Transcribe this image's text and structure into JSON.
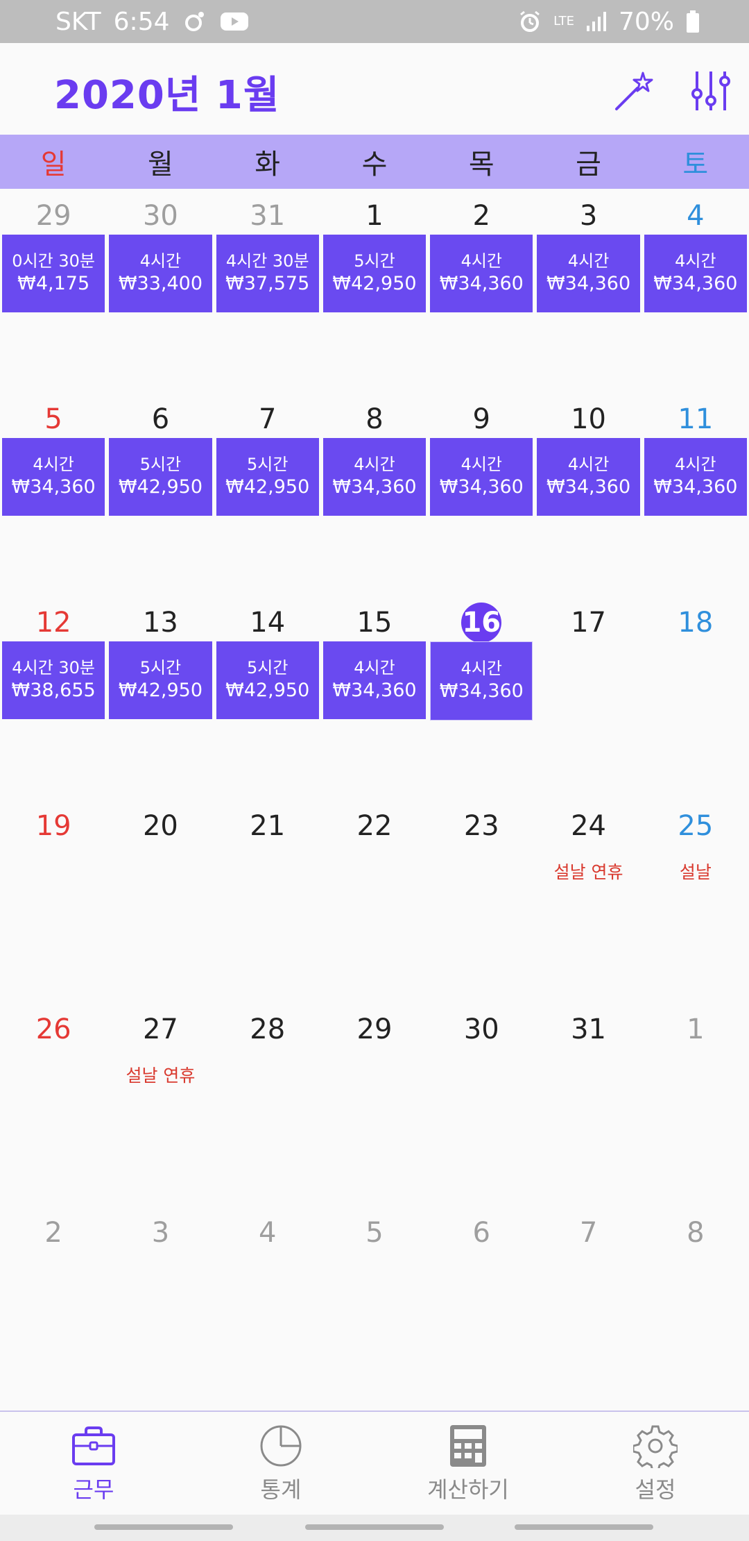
{
  "status_bar": {
    "carrier": "SKT",
    "time": "6:54",
    "network": "LTE",
    "battery": "70%"
  },
  "header": {
    "title": "2020년 1월"
  },
  "weekdays": [
    "일",
    "월",
    "화",
    "수",
    "목",
    "금",
    "토"
  ],
  "calendar": {
    "weeks": [
      [
        {
          "day": "29",
          "muted": true
        },
        {
          "day": "30",
          "muted": true
        },
        {
          "day": "31",
          "muted": true
        },
        {
          "day": "1",
          "hours": "5시간",
          "wage": "₩42,950"
        },
        {
          "day": "2",
          "hours": "4시간",
          "wage": "₩34,360"
        },
        {
          "day": "3",
          "hours": "4시간",
          "wage": "₩34,360"
        },
        {
          "day": "4",
          "hours": "4시간",
          "wage": "₩34,360"
        }
      ],
      [
        {
          "day": "5",
          "hours": "4시간",
          "wage": "₩34,360"
        },
        {
          "day": "6",
          "hours": "5시간",
          "wage": "₩42,950"
        },
        {
          "day": "7",
          "hours": "5시간",
          "wage": "₩42,950"
        },
        {
          "day": "8",
          "hours": "4시간",
          "wage": "₩34,360"
        },
        {
          "day": "9",
          "hours": "4시간",
          "wage": "₩34,360"
        },
        {
          "day": "10",
          "hours": "4시간",
          "wage": "₩34,360"
        },
        {
          "day": "11",
          "hours": "4시간",
          "wage": "₩34,360"
        }
      ],
      [
        {
          "day": "12",
          "hours": "4시간 30분",
          "wage": "₩38,655"
        },
        {
          "day": "13",
          "hours": "5시간",
          "wage": "₩42,950"
        },
        {
          "day": "14",
          "hours": "5시간",
          "wage": "₩42,950"
        },
        {
          "day": "15",
          "hours": "4시간",
          "wage": "₩34,360"
        },
        {
          "day": "16",
          "today": true,
          "hours": "4시간",
          "wage": "₩34,360"
        },
        {
          "day": "17"
        },
        {
          "day": "18"
        }
      ],
      [
        {
          "day": "19"
        },
        {
          "day": "20"
        },
        {
          "day": "21"
        },
        {
          "day": "22"
        },
        {
          "day": "23"
        },
        {
          "day": "24",
          "holiday": "설날 연휴"
        },
        {
          "day": "25",
          "holiday": "설날"
        }
      ],
      [
        {
          "day": "26"
        },
        {
          "day": "27",
          "holiday": "설날 연휴"
        },
        {
          "day": "28"
        },
        {
          "day": "29"
        },
        {
          "day": "30"
        },
        {
          "day": "31"
        },
        {
          "day": "1",
          "muted": true
        }
      ],
      [
        {
          "day": "2",
          "muted": true
        },
        {
          "day": "3",
          "muted": true
        },
        {
          "day": "4",
          "muted": true
        },
        {
          "day": "5",
          "muted": true
        },
        {
          "day": "6",
          "muted": true
        },
        {
          "day": "7",
          "muted": true
        },
        {
          "day": "8",
          "muted": true
        }
      ]
    ],
    "prev_month_entries": [
      {
        "hours": "0시간 30분",
        "wage": "₩4,175"
      },
      {
        "hours": "4시간",
        "wage": "₩33,400"
      },
      {
        "hours": "4시간 30분",
        "wage": "₩37,575"
      }
    ]
  },
  "bottom_nav": [
    {
      "label": "근무",
      "icon": "briefcase-icon",
      "active": true
    },
    {
      "label": "통계",
      "icon": "pie-chart-icon",
      "active": false
    },
    {
      "label": "계산하기",
      "icon": "calculator-icon",
      "active": false
    },
    {
      "label": "설정",
      "icon": "gear-icon",
      "active": false
    }
  ],
  "colors": {
    "accent": "#6a3cf0",
    "work_block": "#6a4af0",
    "weekday_bar": "#b6a7f7",
    "sunday": "#e53935",
    "saturday": "#2f8fdc",
    "holiday": "#d93a2f"
  }
}
